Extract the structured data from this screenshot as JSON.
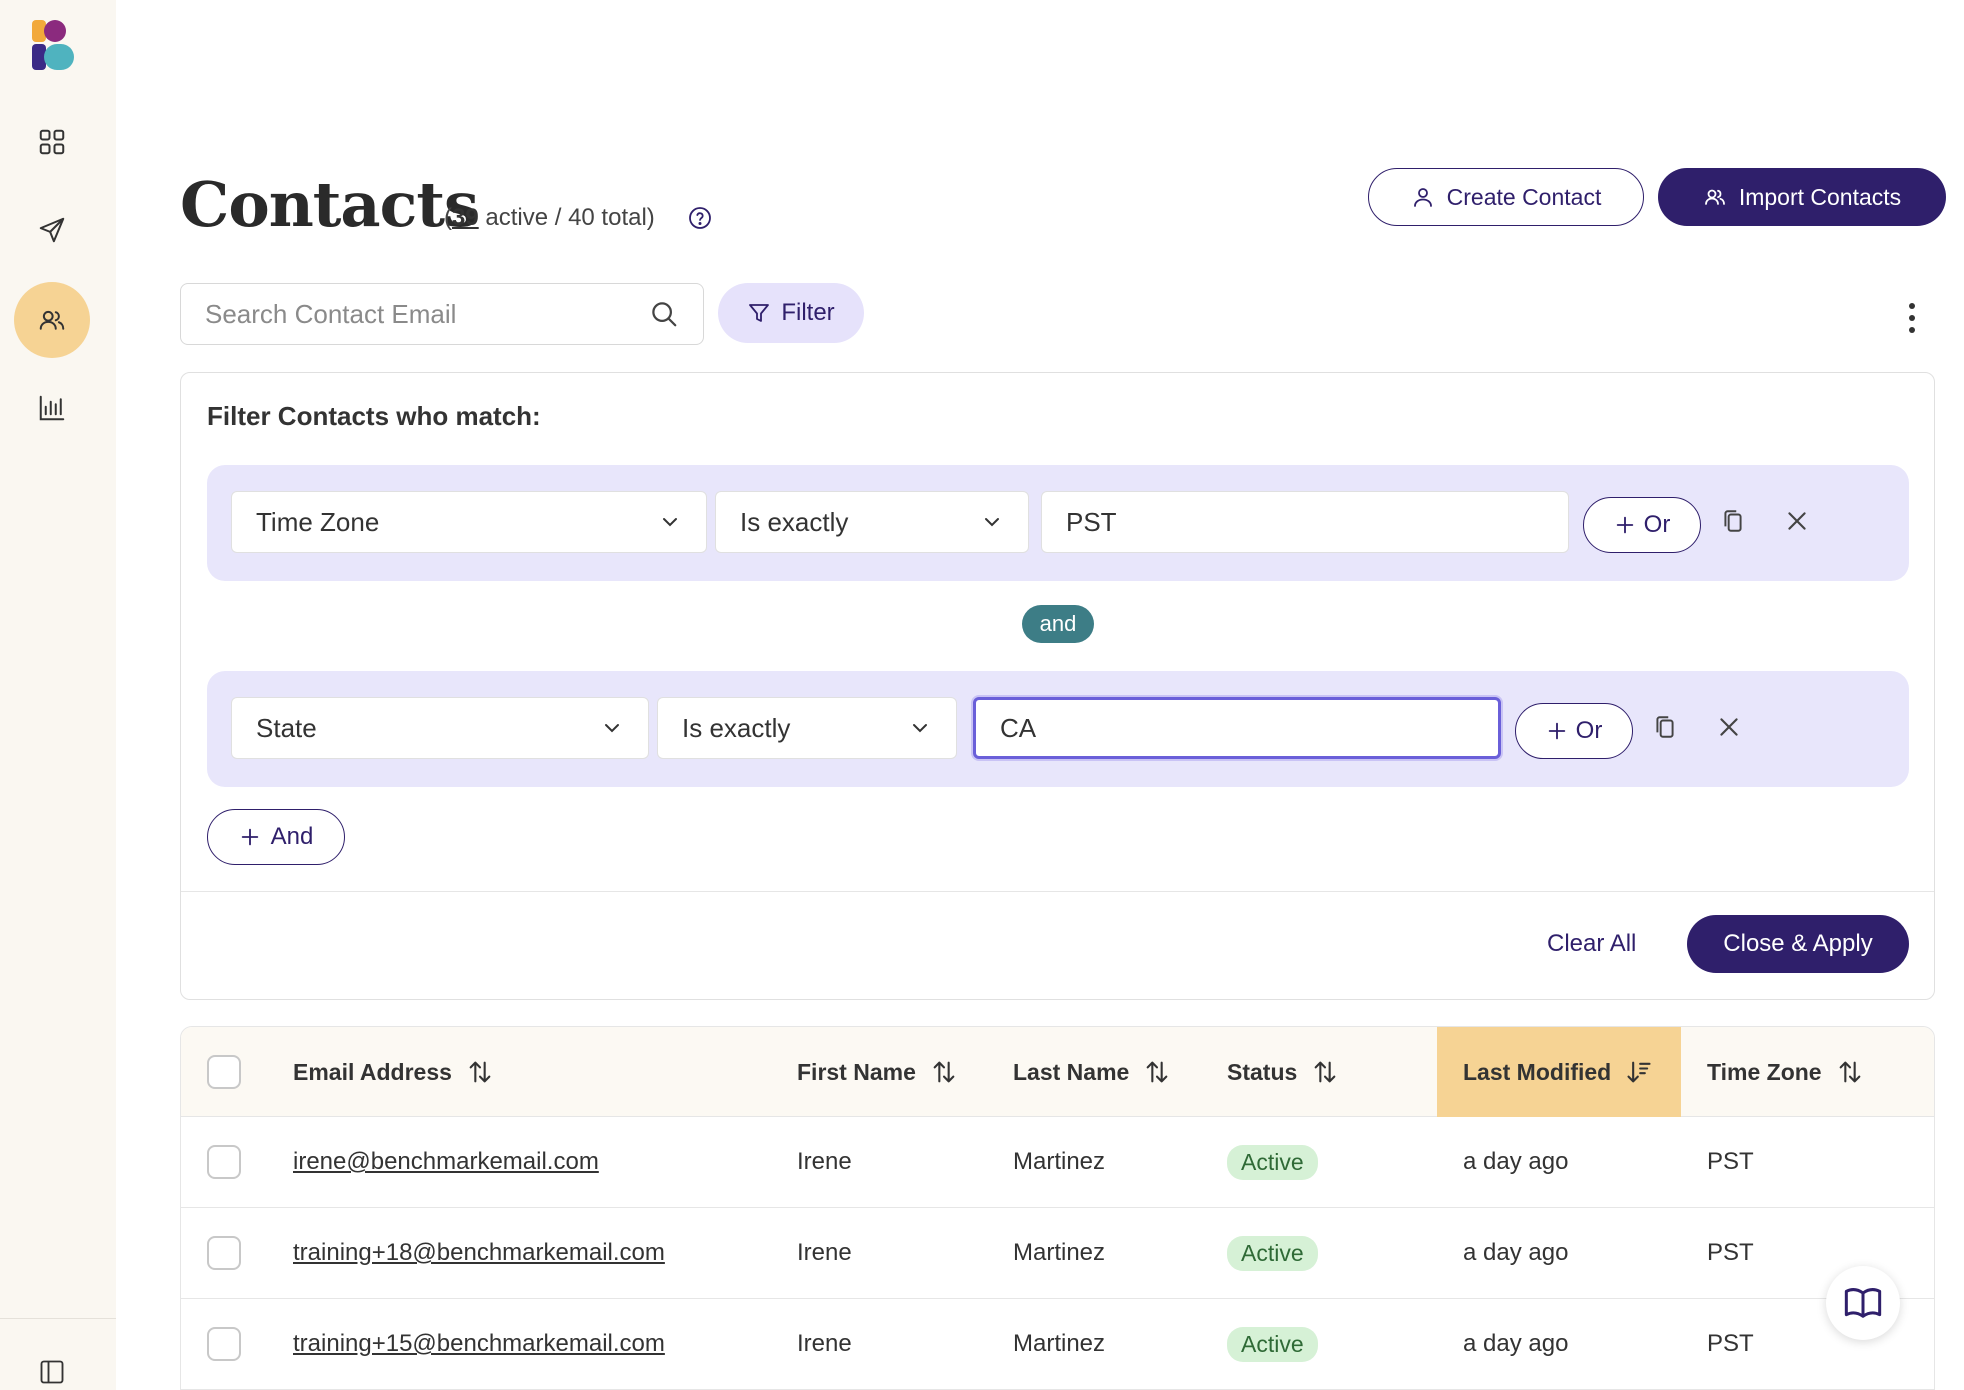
{
  "sidebar": {
    "items": [
      {
        "name": "dashboard",
        "icon": "grid-icon"
      },
      {
        "name": "campaigns",
        "icon": "send-icon"
      },
      {
        "name": "contacts",
        "icon": "contacts-icon",
        "active": true
      },
      {
        "name": "reports",
        "icon": "bar-chart-icon"
      }
    ],
    "toggle_icon": "sidebar-toggle-icon"
  },
  "header": {
    "title": "Contacts",
    "count_open": "(",
    "active_count": "39",
    "count_rest": " active / 40 total)",
    "create_label": "Create Contact",
    "import_label": "Import Contacts"
  },
  "search": {
    "placeholder": "Search Contact Email",
    "value": ""
  },
  "filter_button": "Filter",
  "filter_panel": {
    "heading": "Filter Contacts who match:",
    "rules": [
      {
        "field": "Time Zone",
        "operator": "Is exactly",
        "value": "PST"
      },
      {
        "field": "State",
        "operator": "Is exactly",
        "value": "CA"
      }
    ],
    "or_label": "Or",
    "joiner": "and",
    "and_label": "And",
    "clear_label": "Clear All",
    "apply_label": "Close & Apply"
  },
  "table": {
    "columns": [
      "Email Address",
      "First Name",
      "Last Name",
      "Status",
      "Last Modified",
      "Time Zone"
    ],
    "sorted_column": "Last Modified",
    "rows": [
      {
        "email": "irene@benchmarkemail.com",
        "first": "Irene",
        "last": "Martinez",
        "status": "Active",
        "modified": "a day ago",
        "tz": "PST"
      },
      {
        "email": "training+18@benchmarkemail.com",
        "first": "Irene",
        "last": "Martinez",
        "status": "Active",
        "modified": "a day ago",
        "tz": "PST"
      },
      {
        "email": "training+15@benchmarkemail.com",
        "first": "Irene",
        "last": "Martinez",
        "status": "Active",
        "modified": "a day ago",
        "tz": "PST"
      }
    ]
  },
  "colors": {
    "brand": "#2f1f6b",
    "active_nav": "#f6d394",
    "filter_group_bg": "#e8e6fb",
    "and_badge": "#3d7d86",
    "status_active_bg": "#d6f1d6"
  }
}
